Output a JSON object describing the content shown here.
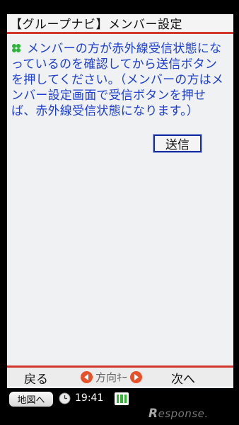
{
  "title_bar": {
    "title": "【グループナビ】メンバー設定"
  },
  "message": {
    "icon": "clover-icon",
    "text": "メンバーの方が赤外線受信状態になっているのを確認してから送信ボタンを押してください。（メンバーの方はメンバー設定画面で受信ボタンを押せば、赤外線受信状態になります。）"
  },
  "send_button": {
    "label": "送信"
  },
  "softkeys": {
    "back": "戻る",
    "direction": "方向ｷｰ",
    "next": "次へ"
  },
  "status_bar": {
    "map_button": "地図へ",
    "time": "19:41"
  },
  "watermark": {
    "text": "Response."
  },
  "colors": {
    "accent_red": "#d0372a",
    "message_blue": "#1e3fd0",
    "arrow_orange": "#e8502a",
    "battery_green": "#2fb52f"
  }
}
